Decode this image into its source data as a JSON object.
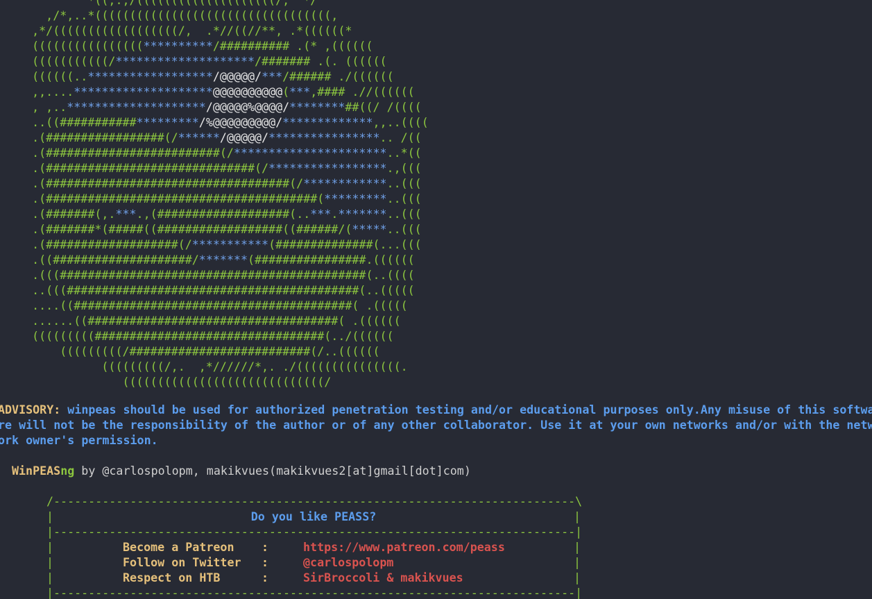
{
  "ascii_art": [
    [
      {
        "t": "            *((,.,/((((((((((((((((((((/,  */",
        "c": "g"
      }
    ],
    [
      {
        "t": "      ,/*,..*((((((((((((((((((((((((((((((((((,",
        "c": "g"
      }
    ],
    [
      {
        "t": "    ,*/((((((((((((((((((/,  .*//((//**, .*((((((*",
        "c": "g"
      }
    ],
    [
      {
        "t": "    ((((((((((((((((",
        "c": "g"
      },
      {
        "t": "**********",
        "c": "b"
      },
      {
        "t": "/########## .(* ,((((((",
        "c": "g"
      }
    ],
    [
      {
        "t": "    (((((((((((/",
        "c": "g"
      },
      {
        "t": "********************",
        "c": "b"
      },
      {
        "t": "/####### .(. ((((((",
        "c": "g"
      }
    ],
    [
      {
        "t": "    ((((((..",
        "c": "g"
      },
      {
        "t": "******************",
        "c": "b"
      },
      {
        "t": "/",
        "c": "w"
      },
      {
        "t": "@@@@@",
        "c": "w"
      },
      {
        "t": "/",
        "c": "w"
      },
      {
        "t": "***",
        "c": "b"
      },
      {
        "t": "/###### ./((((((",
        "c": "g"
      }
    ],
    [
      {
        "t": "    ,,....",
        "c": "g"
      },
      {
        "t": "********************",
        "c": "b"
      },
      {
        "t": "@@@@@@@@@@",
        "c": "w"
      },
      {
        "t": "(",
        "c": "g"
      },
      {
        "t": "***",
        "c": "b"
      },
      {
        "t": ",#### .//((((((",
        "c": "g"
      }
    ],
    [
      {
        "t": "    , ,..",
        "c": "g"
      },
      {
        "t": "********************",
        "c": "b"
      },
      {
        "t": "/@@@@@%@@@@/",
        "c": "w"
      },
      {
        "t": "********",
        "c": "b"
      },
      {
        "t": "##((/ /((((",
        "c": "g"
      }
    ],
    [
      {
        "t": "    ..((###########",
        "c": "g"
      },
      {
        "t": "*********",
        "c": "b"
      },
      {
        "t": "/%@@@@@@@@@/",
        "c": "w"
      },
      {
        "t": "*************",
        "c": "b"
      },
      {
        "t": ",,..((((",
        "c": "g"
      }
    ],
    [
      {
        "t": "    .(#################(/",
        "c": "g"
      },
      {
        "t": "******",
        "c": "b"
      },
      {
        "t": "/@@@@@/",
        "c": "w"
      },
      {
        "t": "****************",
        "c": "b"
      },
      {
        "t": ".. /((",
        "c": "g"
      }
    ],
    [
      {
        "t": "    .(#########################(/",
        "c": "g"
      },
      {
        "t": "**********************",
        "c": "b"
      },
      {
        "t": "..*((",
        "c": "g"
      }
    ],
    [
      {
        "t": "    .(##############################(/",
        "c": "g"
      },
      {
        "t": "*****************",
        "c": "b"
      },
      {
        "t": ".,(((",
        "c": "g"
      }
    ],
    [
      {
        "t": "    .(###################################(/",
        "c": "g"
      },
      {
        "t": "************",
        "c": "b"
      },
      {
        "t": "..(((",
        "c": "g"
      }
    ],
    [
      {
        "t": "    .(#######################################(",
        "c": "g"
      },
      {
        "t": "*********",
        "c": "b"
      },
      {
        "t": "..(((",
        "c": "g"
      }
    ],
    [
      {
        "t": "    .(#######(,.",
        "c": "g"
      },
      {
        "t": "***",
        "c": "b"
      },
      {
        "t": ".,(###################(..",
        "c": "g"
      },
      {
        "t": "***",
        "c": "b"
      },
      {
        "t": ".",
        "c": "g"
      },
      {
        "t": "*******",
        "c": "b"
      },
      {
        "t": "..(((",
        "c": "g"
      }
    ],
    [
      {
        "t": "    .(#######*(#####((##################((######/(",
        "c": "g"
      },
      {
        "t": "*****",
        "c": "b"
      },
      {
        "t": "..(((",
        "c": "g"
      }
    ],
    [
      {
        "t": "    .(###################(/",
        "c": "g"
      },
      {
        "t": "***********",
        "c": "b"
      },
      {
        "t": "(##############(...(((",
        "c": "g"
      }
    ],
    [
      {
        "t": "    .((####################/",
        "c": "g"
      },
      {
        "t": "*******",
        "c": "b"
      },
      {
        "t": "(################.((((((",
        "c": "g"
      }
    ],
    [
      {
        "t": "    .(((############################################(..((((",
        "c": "g"
      }
    ],
    [
      {
        "t": "    ..(((##########################################(..(((((",
        "c": "g"
      }
    ],
    [
      {
        "t": "    ....((########################################( .(((((",
        "c": "g"
      }
    ],
    [
      {
        "t": "    ......((####################################( .((((((",
        "c": "g"
      }
    ],
    [
      {
        "t": "    (((((((((#################################(../((((((",
        "c": "g"
      }
    ],
    [
      {
        "t": "        (((((((((/##########################(/..((((((",
        "c": "g"
      }
    ],
    [
      {
        "t": "              (((((((((/,.  ,*//////*,. ./(((((((((((((((.",
        "c": "g"
      }
    ],
    [
      {
        "t": "                 (((((((((((((((((((((((((((((/",
        "c": "g"
      }
    ]
  ],
  "advisory": {
    "label": "ADVISORY:",
    "line1": " winpeas should be used for authorized penetration testing and/or educational purposes only.Any misuse of this softwa",
    "line2": "re will not be the responsibility of the author or of any other collaborator. Use it at your own networks and/or with the netw",
    "line3": "ork owner's permission."
  },
  "credits": {
    "name_main": "WinPEAS",
    "name_suffix": "ng",
    "by_text": " by @carlospolopm, makikvues(makikvues2[at]gmail[dot]com)"
  },
  "box": {
    "top": "/---------------------------------------------------------------------------\\",
    "title": "Do you like PEASS?",
    "separator": "|---------------------------------------------------------------------------|",
    "rows": [
      {
        "label": "Become a Patreon",
        "colon": ":",
        "value": "https://www.patreon.com/peass"
      },
      {
        "label": "Follow on Twitter",
        "colon": ":",
        "value": "@carlospolopm"
      },
      {
        "label": "Respect on HTB",
        "colon": ":",
        "value": "SirBroccoli & makikvues"
      }
    ],
    "bottom": "|---------------------------------------------------------------------------|"
  },
  "colors": {
    "background": "#272a34",
    "green": "#8cc63f",
    "blue": "#6f9fe6",
    "yellow": "#e5c07b",
    "red": "#d9534f"
  }
}
